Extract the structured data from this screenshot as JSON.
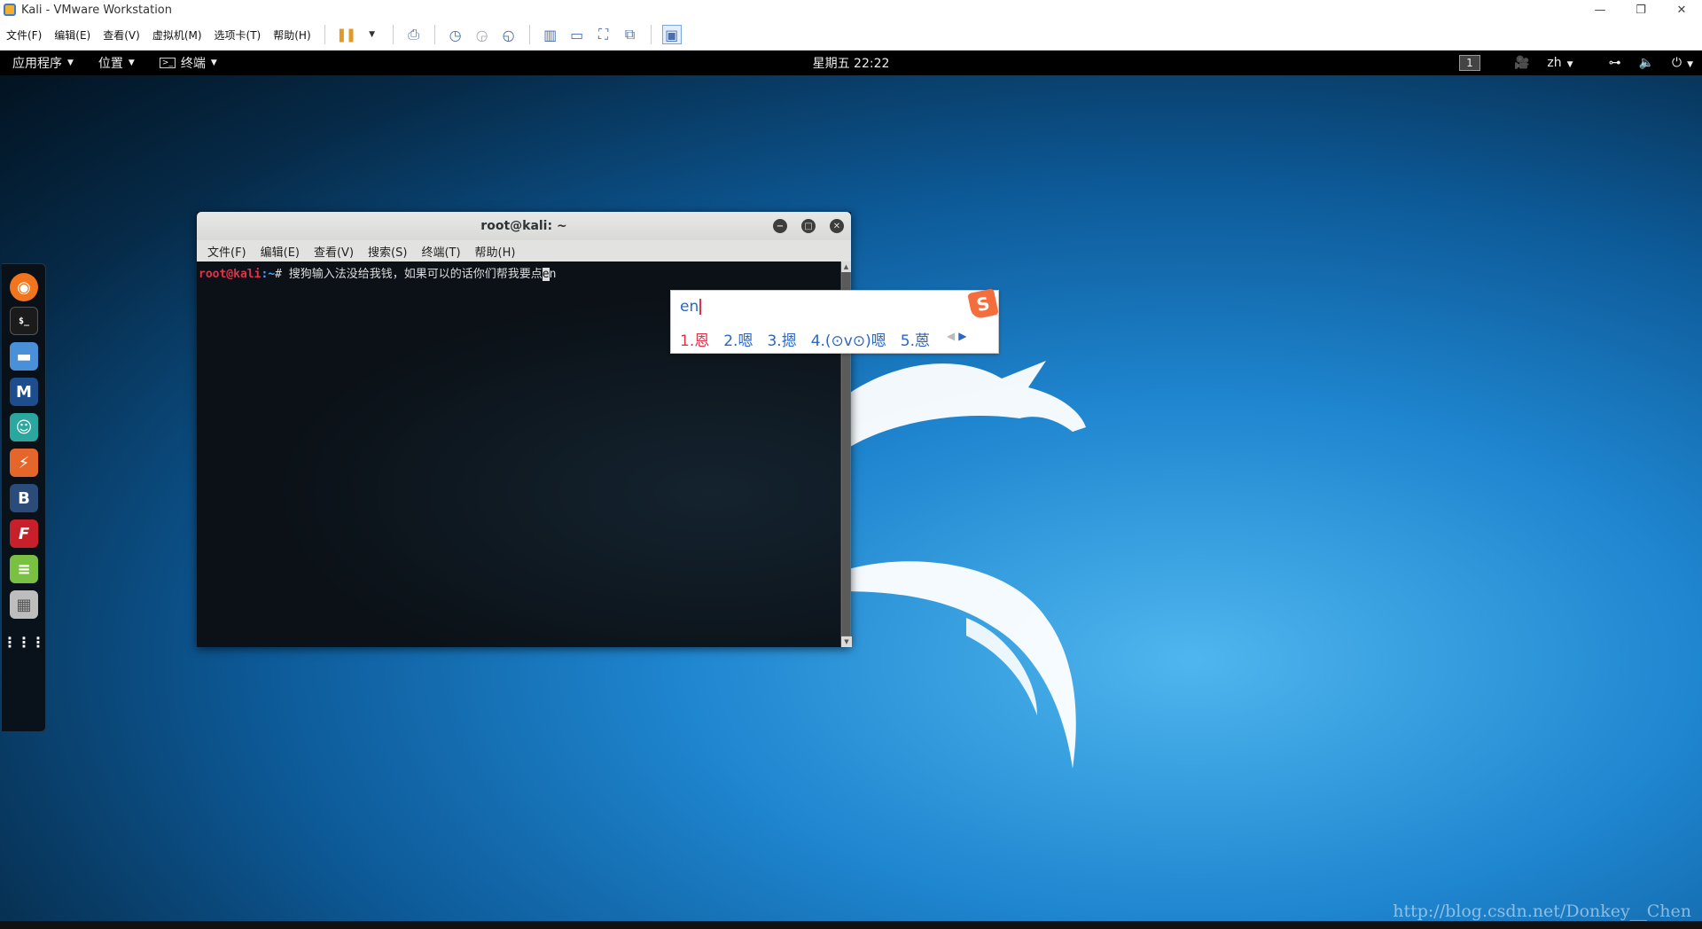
{
  "vmware": {
    "title": "Kali - VMware Workstation",
    "window_buttons": [
      "—",
      "❐",
      "✕"
    ],
    "menu": [
      "文件(F)",
      "编辑(E)",
      "查看(V)",
      "虚拟机(M)",
      "选项卡(T)",
      "帮助(H)"
    ]
  },
  "gnome": {
    "applications": "应用程序",
    "places": "位置",
    "terminal_menu": "终端",
    "clock": "星期五 22:22",
    "workspace": "1",
    "lang": "zh"
  },
  "terminal": {
    "title": "root@kali: ~",
    "menu": [
      "文件(F)",
      "编辑(E)",
      "查看(V)",
      "搜索(S)",
      "终端(T)",
      "帮助(H)"
    ],
    "prompt_user": "root@kali",
    "prompt_path": ":~",
    "prompt_symbol": "# ",
    "command": "搜狗输入法没给我钱，如果可以的话你们帮我要点",
    "cursor_char": "e",
    "after_cursor": "n"
  },
  "ime": {
    "composition": "en",
    "logo": "S",
    "candidates": [
      "1.恩",
      "2.嗯",
      "3.摁",
      "4.(⊙v⊙)嗯",
      "5.蒽"
    ],
    "pager_prev": "◀",
    "pager_next": "▶"
  },
  "dock": {
    "icons": [
      "firefox-icon",
      "terminal-icon",
      "files-icon",
      "metasploit-icon",
      "armitage-icon",
      "burpsuite-icon",
      "beef-icon",
      "faraday-icon",
      "leafpad-icon",
      "cherrytree-icon",
      "show-apps-icon"
    ]
  },
  "watermark": "http://blog.csdn.net/Donkey__Chen",
  "colors": {
    "prompt_user": "#e0334a",
    "prompt_path": "#4aa3ff",
    "ime_text": "#2a67c7",
    "ime_selected": "#e0334a"
  }
}
